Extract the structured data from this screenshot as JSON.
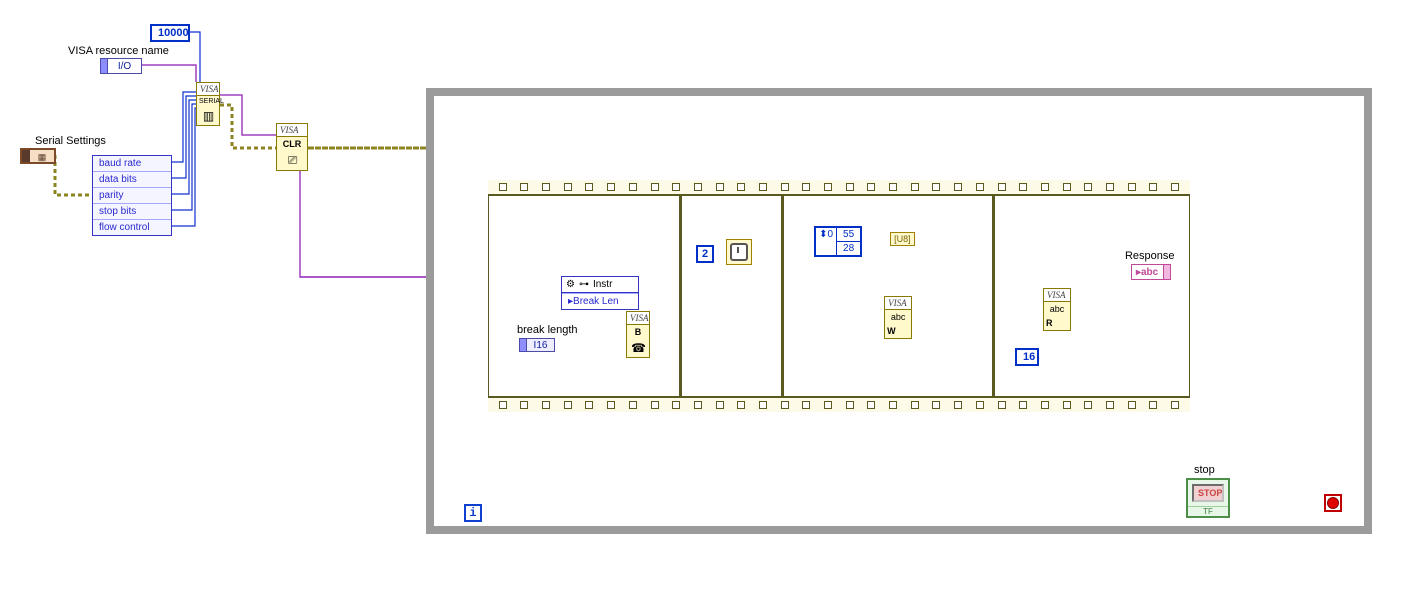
{
  "labels": {
    "visa_resource_name": "VISA resource name",
    "serial_settings": "Serial Settings",
    "break_length": "break length",
    "response": "Response",
    "stop": "stop"
  },
  "constants": {
    "timeout": "10000",
    "wait_ms": "2",
    "read_bytes": "16",
    "array_index": "0",
    "array_v0": "55",
    "array_v1": "28"
  },
  "terminals": {
    "io_type": "I/O",
    "i16_type": "I16",
    "abc_type": "abc"
  },
  "unbundle_rows": [
    "baud rate",
    "data bits",
    "parity",
    "stop bits",
    "flow control"
  ],
  "nodes": {
    "visa_serial_head": "VISA",
    "visa_serial_sub": "SERIAL",
    "visa_clr_head": "VISA",
    "visa_clr_body": "CLR",
    "visa_write_head": "VISA",
    "visa_write_body": "abc",
    "visa_write_tag": "W",
    "visa_read_head": "VISA",
    "visa_read_body": "abc",
    "visa_read_tag": "R",
    "visa_break_head": "VISA",
    "visa_break_body": "B",
    "prop_node_class": "Instr",
    "prop_node_row": "Break Len",
    "u8_to_str": "[U8]",
    "stop_btn": "STOP",
    "stop_tf": "TF",
    "iter_i": "i",
    "arrow_glyph": "▸",
    "plug_glyph": "⊶"
  }
}
